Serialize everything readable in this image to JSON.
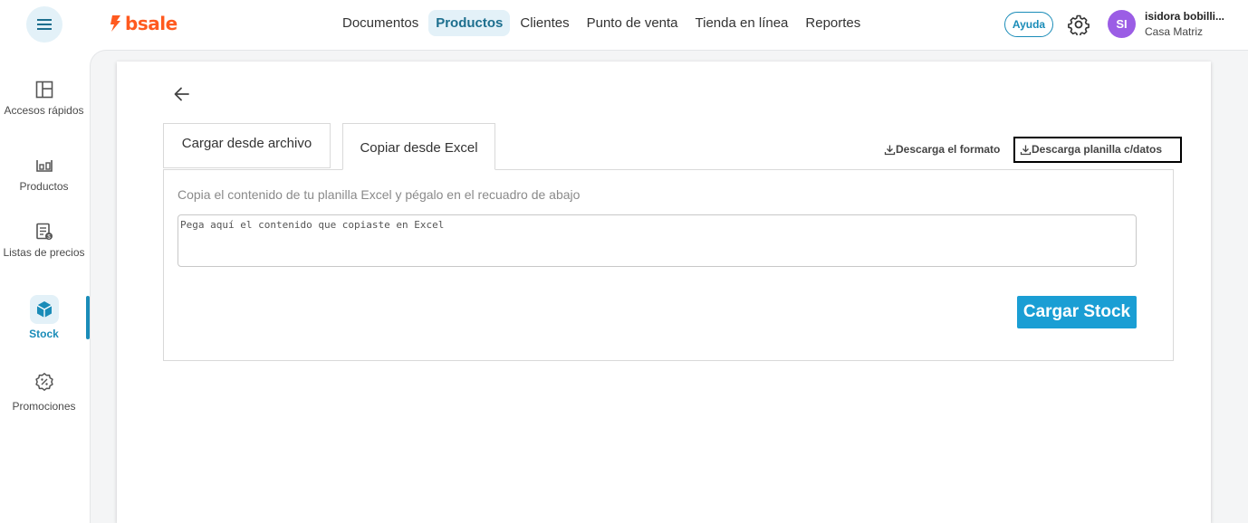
{
  "header": {
    "logo_text": "bsale",
    "nav": [
      {
        "label": "Documentos",
        "active": false
      },
      {
        "label": "Productos",
        "active": true
      },
      {
        "label": "Clientes",
        "active": false
      },
      {
        "label": "Punto de venta",
        "active": false
      },
      {
        "label": "Tienda en línea",
        "active": false
      },
      {
        "label": "Reportes",
        "active": false
      }
    ],
    "help_label": "Ayuda",
    "user": {
      "initials": "SI",
      "name": "isidora bobilli...",
      "branch": "Casa Matriz"
    }
  },
  "sidebar": {
    "items": [
      {
        "label": "Accesos rápidos",
        "icon": "layout-icon"
      },
      {
        "label": "Productos",
        "icon": "products-icon"
      },
      {
        "label": "Listas de precios",
        "icon": "price-list-icon"
      },
      {
        "label": "Stock",
        "icon": "cube-icon",
        "active": true
      },
      {
        "label": "Promociones",
        "icon": "discount-icon"
      }
    ]
  },
  "main": {
    "tabs": [
      {
        "label": "Cargar desde archivo",
        "active": false
      },
      {
        "label": "Copiar desde Excel",
        "active": true
      }
    ],
    "download_format_label": "Descarga el formato",
    "download_with_data_label": "Descarga planilla c/datos",
    "instruction": "Copia el contenido de tu planilla Excel y pégalo en el recuadro de abajo",
    "paste_placeholder": "Pega aquí el contenido que copiaste en Excel",
    "paste_value": "",
    "submit_label": "Cargar Stock"
  },
  "colors": {
    "accent": "#1a9ed4",
    "brand": "#ff5a1f",
    "avatar": "#9b5de5",
    "nav_active_bg": "#e3f1f8"
  }
}
